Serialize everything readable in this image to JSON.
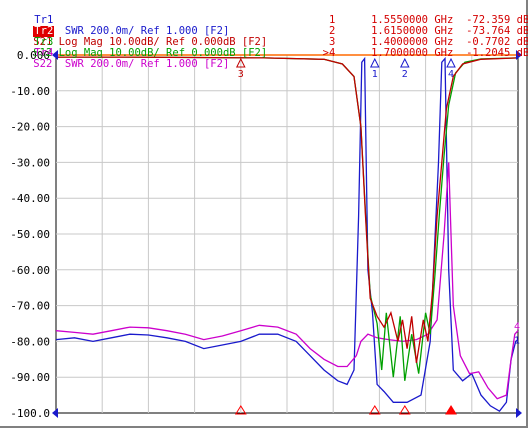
{
  "traces": [
    {
      "tag": "Tr1",
      "active": false,
      "color": "#1a1acc",
      "text": "S11  SWR 200.0m/ Ref 1.000 [F2]"
    },
    {
      "tag": "Tr2",
      "active": true,
      "color": "#c00000",
      "text": "S21 Log Mag 10.00dB/ Ref 0.000dB [F2]"
    },
    {
      "tag": "Tr3",
      "active": false,
      "color": "#00a000",
      "text": "S12 Log Mag 10.00dB/ Ref 0.000dB [F2]"
    },
    {
      "tag": "Tr4",
      "active": false,
      "color": "#cc00cc",
      "text": "S22  SWR 200.0m/ Ref 1.000 [F2]"
    }
  ],
  "markers": [
    {
      "id": "1",
      "freq": "1.5550000 GHz",
      "value": "-72.359 dB"
    },
    {
      "id": "2",
      "freq": "1.6150000 GHz",
      "value": "-73.764 dB"
    },
    {
      "id": "3",
      "freq": "1.4000000 GHz",
      "value": "-0.7702 dB"
    },
    {
      "id": ">4",
      "freq": "1.7000000 GHz",
      "value": "-1.2045 dB"
    }
  ],
  "chart_data": {
    "type": "line",
    "ylim": [
      -100,
      0
    ],
    "y_ticks": [
      "0.000",
      "-10.00",
      "-20.00",
      "-30.00",
      "-40.00",
      "-50.00",
      "-60.00",
      "-70.00",
      "-80.00",
      "-90.00",
      "-100.0"
    ],
    "x_divisions": 10,
    "grid": true,
    "colors": {
      "s11": "#1a1acc",
      "s21": "#c00000",
      "s12": "#00a000",
      "s22": "#cc00cc"
    },
    "right_labels": {
      "tr1": "1",
      "tr4": "4"
    },
    "series": [
      {
        "key": "s21",
        "points": [
          [
            0,
            -0.6
          ],
          [
            1.5,
            -0.6
          ],
          [
            3,
            -0.7
          ],
          [
            4.5,
            -0.8
          ],
          [
            5.8,
            -1.2
          ],
          [
            6.2,
            -2.5
          ],
          [
            6.45,
            -6
          ],
          [
            6.6,
            -20
          ],
          [
            6.7,
            -45
          ],
          [
            6.8,
            -68
          ],
          [
            6.95,
            -73
          ],
          [
            7.1,
            -76
          ],
          [
            7.25,
            -72
          ],
          [
            7.4,
            -80
          ],
          [
            7.5,
            -74
          ],
          [
            7.6,
            -82
          ],
          [
            7.7,
            -73
          ],
          [
            7.8,
            -86
          ],
          [
            7.95,
            -74
          ],
          [
            8.05,
            -80
          ],
          [
            8.15,
            -66
          ],
          [
            8.25,
            -45
          ],
          [
            8.35,
            -30
          ],
          [
            8.45,
            -15
          ],
          [
            8.6,
            -6
          ],
          [
            8.8,
            -2.5
          ],
          [
            9.2,
            -1.2
          ],
          [
            10,
            -0.8
          ]
        ]
      },
      {
        "key": "s12",
        "points": [
          [
            0,
            -0.6
          ],
          [
            1.5,
            -0.6
          ],
          [
            3,
            -0.7
          ],
          [
            4.5,
            -0.8
          ],
          [
            5.8,
            -1.2
          ],
          [
            6.2,
            -2.5
          ],
          [
            6.45,
            -6
          ],
          [
            6.6,
            -20
          ],
          [
            6.7,
            -44
          ],
          [
            6.8,
            -67
          ],
          [
            6.95,
            -75
          ],
          [
            7.05,
            -88
          ],
          [
            7.15,
            -72
          ],
          [
            7.3,
            -90
          ],
          [
            7.45,
            -73
          ],
          [
            7.55,
            -91
          ],
          [
            7.7,
            -78
          ],
          [
            7.85,
            -89
          ],
          [
            8.0,
            -72
          ],
          [
            8.1,
            -78
          ],
          [
            8.2,
            -62
          ],
          [
            8.3,
            -44
          ],
          [
            8.4,
            -28
          ],
          [
            8.5,
            -14
          ],
          [
            8.65,
            -5
          ],
          [
            8.85,
            -2
          ],
          [
            9.2,
            -1.1
          ],
          [
            10,
            -0.8
          ]
        ]
      },
      {
        "key": "s11",
        "points": [
          [
            0,
            -79.5
          ],
          [
            0.4,
            -79
          ],
          [
            0.8,
            -80
          ],
          [
            1.2,
            -79
          ],
          [
            1.6,
            -78
          ],
          [
            2.0,
            -78.2
          ],
          [
            2.4,
            -79
          ],
          [
            2.8,
            -80
          ],
          [
            3.2,
            -82
          ],
          [
            3.6,
            -81
          ],
          [
            4.0,
            -80
          ],
          [
            4.4,
            -78
          ],
          [
            4.8,
            -78
          ],
          [
            5.2,
            -80
          ],
          [
            5.5,
            -84
          ],
          [
            5.8,
            -88
          ],
          [
            6.1,
            -91
          ],
          [
            6.3,
            -92
          ],
          [
            6.45,
            -88
          ],
          [
            6.55,
            -45
          ],
          [
            6.62,
            -2
          ],
          [
            6.68,
            -1
          ],
          [
            6.75,
            -60
          ],
          [
            6.85,
            -72
          ],
          [
            6.95,
            -92
          ],
          [
            7.1,
            -94
          ],
          [
            7.3,
            -97
          ],
          [
            7.6,
            -97
          ],
          [
            7.9,
            -95
          ],
          [
            8.1,
            -80
          ],
          [
            8.28,
            -30
          ],
          [
            8.35,
            -2
          ],
          [
            8.42,
            -1
          ],
          [
            8.5,
            -60
          ],
          [
            8.6,
            -88
          ],
          [
            8.8,
            -91
          ],
          [
            9.0,
            -89
          ],
          [
            9.2,
            -95
          ],
          [
            9.4,
            -98
          ],
          [
            9.6,
            -99.5
          ],
          [
            9.75,
            -97
          ],
          [
            9.85,
            -85
          ],
          [
            9.95,
            -80
          ],
          [
            10,
            -79.5
          ]
        ]
      },
      {
        "key": "s22",
        "points": [
          [
            0,
            -77
          ],
          [
            0.4,
            -77.5
          ],
          [
            0.8,
            -78
          ],
          [
            1.2,
            -77
          ],
          [
            1.6,
            -76
          ],
          [
            2.0,
            -76.2
          ],
          [
            2.4,
            -77
          ],
          [
            2.8,
            -78
          ],
          [
            3.2,
            -79.5
          ],
          [
            3.6,
            -78.5
          ],
          [
            4.0,
            -77
          ],
          [
            4.4,
            -75.5
          ],
          [
            4.8,
            -76
          ],
          [
            5.2,
            -78
          ],
          [
            5.5,
            -82
          ],
          [
            5.8,
            -85
          ],
          [
            6.1,
            -87
          ],
          [
            6.3,
            -87
          ],
          [
            6.5,
            -84
          ],
          [
            6.6,
            -80
          ],
          [
            6.75,
            -78
          ],
          [
            6.95,
            -79
          ],
          [
            7.2,
            -79.5
          ],
          [
            7.5,
            -80
          ],
          [
            7.8,
            -79.5
          ],
          [
            8.05,
            -78
          ],
          [
            8.25,
            -74
          ],
          [
            8.4,
            -50
          ],
          [
            8.5,
            -30
          ],
          [
            8.6,
            -70
          ],
          [
            8.75,
            -84
          ],
          [
            8.95,
            -89
          ],
          [
            9.15,
            -88.5
          ],
          [
            9.35,
            -93
          ],
          [
            9.55,
            -96
          ],
          [
            9.75,
            -95
          ],
          [
            9.85,
            -85
          ],
          [
            9.93,
            -78
          ],
          [
            10,
            -77
          ]
        ]
      }
    ],
    "marker_positions": [
      {
        "id": "1",
        "x": 6.9,
        "y": -72.36,
        "label_y": -2.8
      },
      {
        "id": "2",
        "x": 7.55,
        "y": -73.76,
        "label_y": -2.8
      },
      {
        "id": "3",
        "x": 4.0,
        "y": -0.77,
        "label_y": -2.8
      },
      {
        "id": "4",
        "x": 8.55,
        "y": -1.2,
        "label_y": -2.8
      }
    ]
  }
}
